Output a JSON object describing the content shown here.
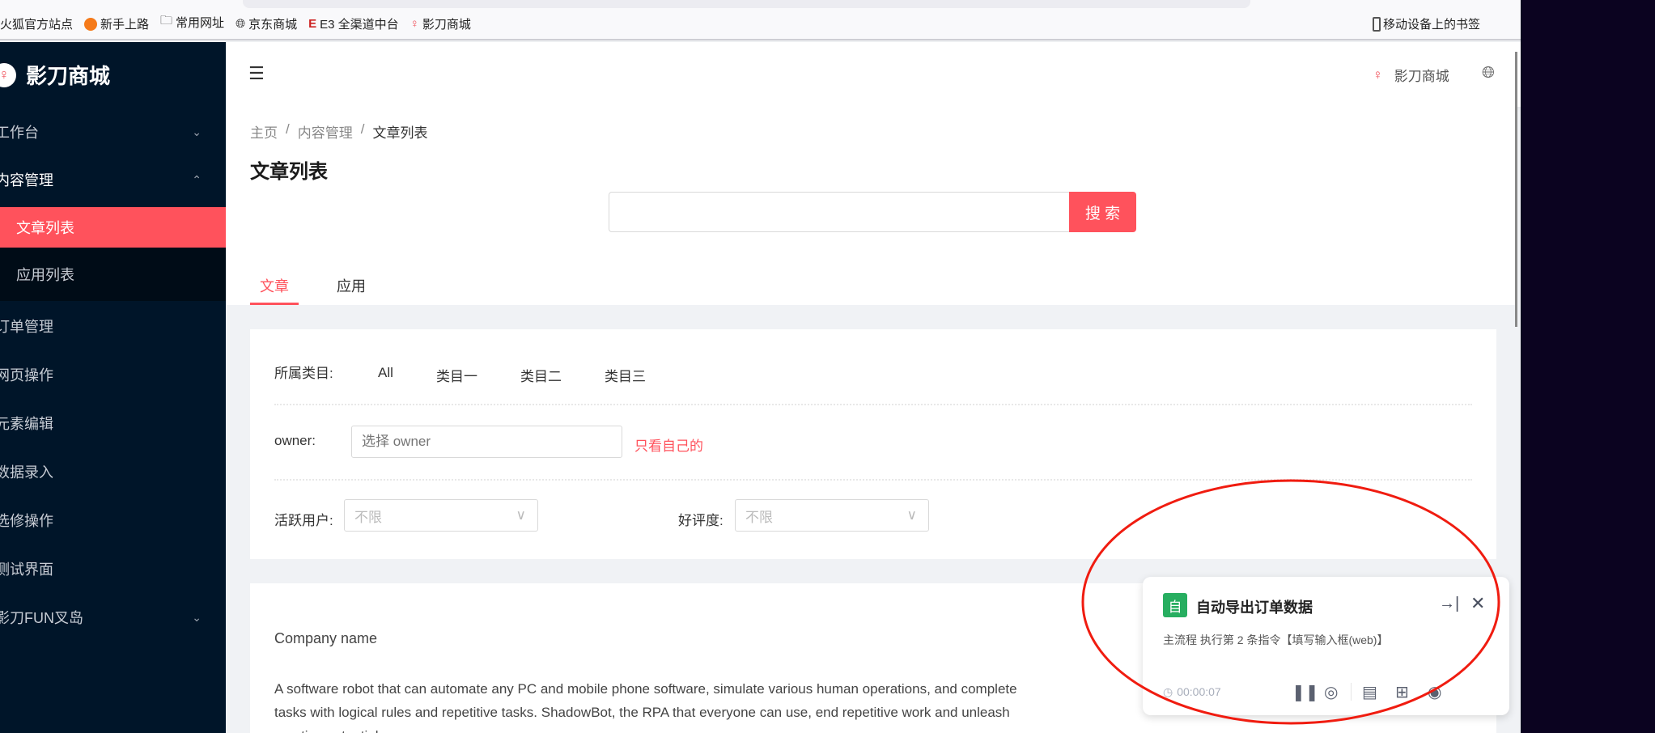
{
  "browser": {
    "bookmarks": [
      "火狐官方站点",
      "新手上路",
      "常用网址",
      "京东商城",
      "E3 全渠道中台",
      "影刀商城"
    ],
    "mobile_bookmarks": "移动设备上的书签"
  },
  "sidebar": {
    "brand": "影刀商城",
    "items": [
      {
        "label": "工作台"
      },
      {
        "label": "内容管理"
      },
      {
        "label": "文章列表"
      },
      {
        "label": "应用列表"
      },
      {
        "label": "订单管理"
      },
      {
        "label": "网页操作"
      },
      {
        "label": "元素编辑"
      },
      {
        "label": "数据录入"
      },
      {
        "label": "选修操作"
      },
      {
        "label": "测试界面"
      },
      {
        "label": "影刀FUN叉岛"
      }
    ]
  },
  "header": {
    "brand": "影刀商城"
  },
  "breadcrumb": [
    "主页",
    "内容管理",
    "文章列表"
  ],
  "page_title": "文章列表",
  "search": {
    "value": "",
    "button": "搜 索"
  },
  "tabs": [
    {
      "label": "文章",
      "active": true
    },
    {
      "label": "应用",
      "active": false
    }
  ],
  "filters": {
    "category_label": "所属类目:",
    "categories": [
      "All",
      "类目一",
      "类目二",
      "类目三"
    ],
    "owner_label": "owner:",
    "owner_placeholder": "选择 owner",
    "owner_only_mine": "只看自己的",
    "active_label": "活跃用户:",
    "active_value": "不限",
    "rating_label": "好评度:",
    "rating_value": "不限"
  },
  "article": {
    "company": "Company name",
    "body": "A software robot that can automate any PC and mobile phone software, simulate various human operations, and complete tasks with logical rules and repetitive tasks. ShadowBot, the RPA that everyone can use, end repetitive work and unleash creative potential."
  },
  "panel": {
    "badge": "自",
    "title": "自动导出订单数据",
    "status": "主流程 执行第 2 条指令【填写输入框(web)】",
    "timer": "00:00:07",
    "accent": "#27ae60"
  },
  "colors": {
    "primary": "#ff525c",
    "sidebar": "#001529"
  }
}
